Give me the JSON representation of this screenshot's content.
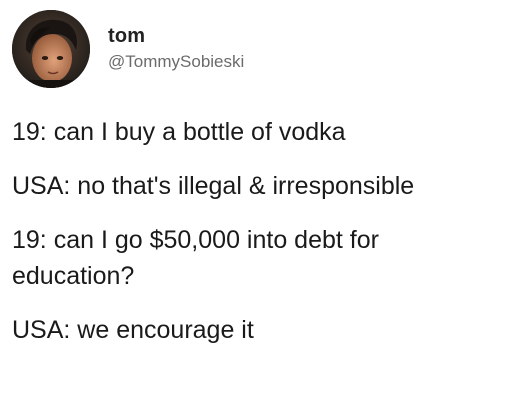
{
  "author": {
    "display_name": "tom",
    "handle": "@TommySobieski",
    "avatar_icon": "profile-photo"
  },
  "tweet": {
    "lines": [
      "19: can I buy a bottle of vodka",
      "USA: no that's illegal & irresponsible",
      "19: can I go $50,000 into debt for",
      "education?",
      "USA: we encourage it"
    ]
  }
}
